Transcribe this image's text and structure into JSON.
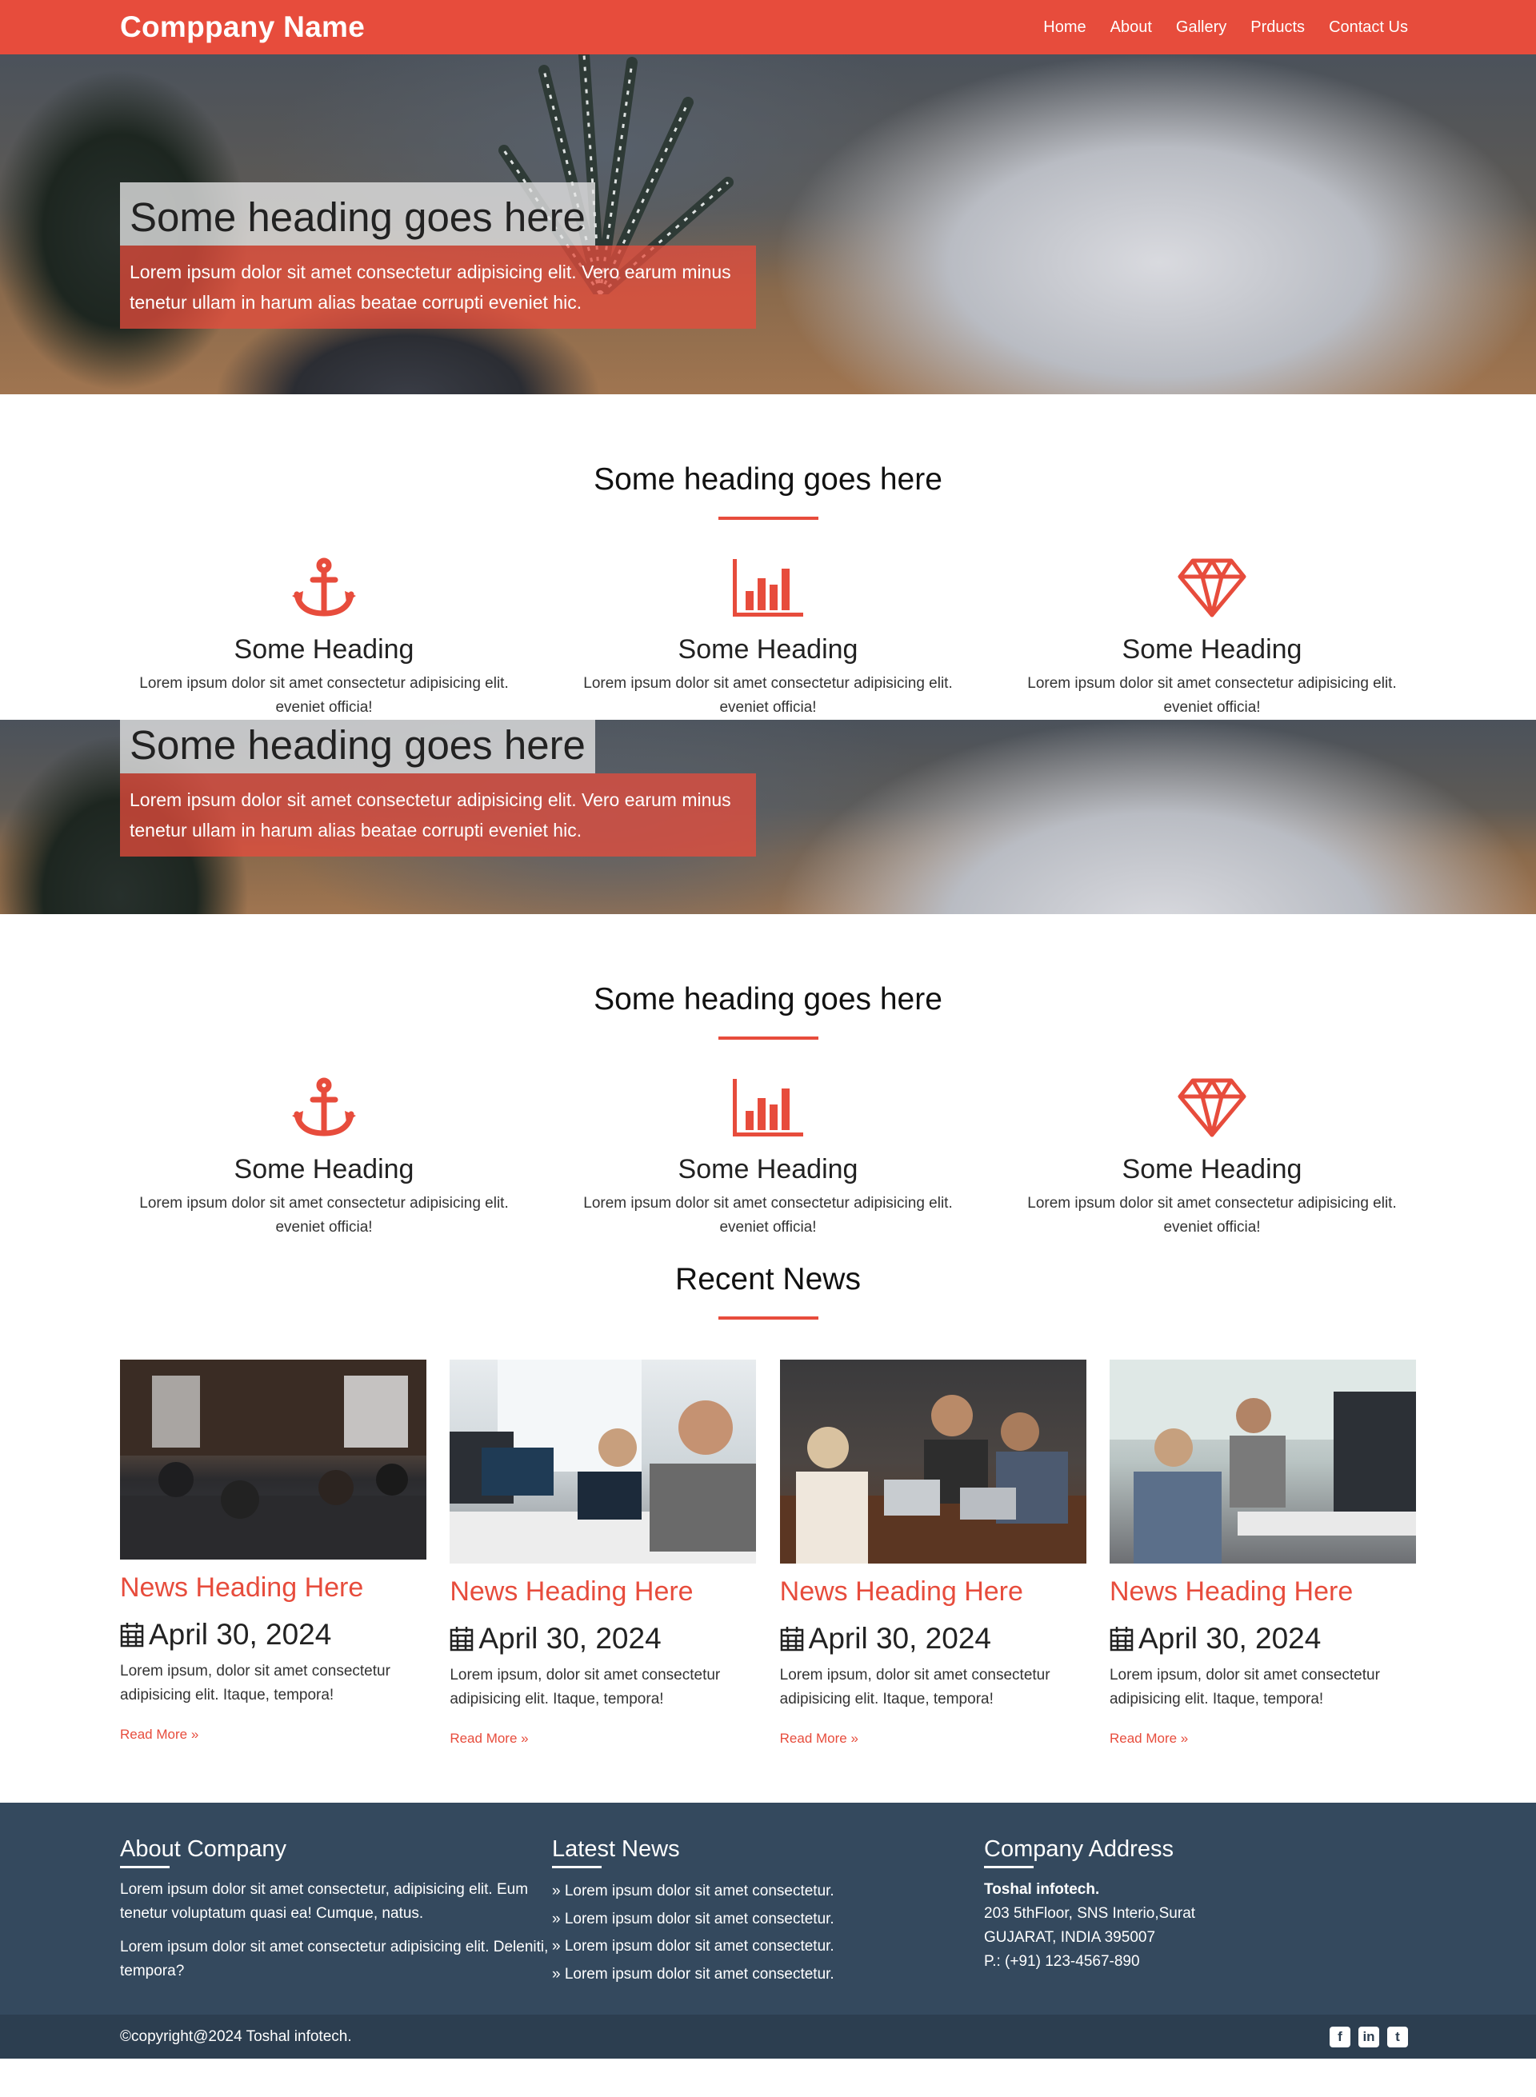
{
  "navbar": {
    "brand": "Comppany Name",
    "links": [
      "Home",
      "About",
      "Gallery",
      "Prducts",
      "Contact Us"
    ]
  },
  "hero": {
    "title": "Some heading goes here",
    "text": "Lorem ipsum dolor sit amet consectetur adipisicing elit. Vero earum minus tenetur ullam in harum alias beatae corrupti eveniet hic."
  },
  "features": {
    "title": "Some heading goes here",
    "items": [
      {
        "icon": "anchor-icon",
        "heading": "Some Heading",
        "text": "Lorem ipsum dolor sit amet consectetur adipisicing elit. eveniet officia!"
      },
      {
        "icon": "bar-chart-icon",
        "heading": "Some Heading",
        "text": "Lorem ipsum dolor sit amet consectetur adipisicing elit. eveniet officia!"
      },
      {
        "icon": "diamond-icon",
        "heading": "Some Heading",
        "text": "Lorem ipsum dolor sit amet consectetur adipisicing elit. eveniet officia!"
      }
    ]
  },
  "news": {
    "title": "Recent News",
    "items": [
      {
        "heading": "News Heading Here",
        "date": "April 30, 2024",
        "text": "Lorem ipsum, dolor sit amet consectetur adipisicing elit. Itaque, tempora!",
        "read_more": "Read More »"
      },
      {
        "heading": "News Heading Here",
        "date": "April 30, 2024",
        "text": "Lorem ipsum, dolor sit amet consectetur adipisicing elit. Itaque, tempora!",
        "read_more": "Read More »"
      },
      {
        "heading": "News Heading Here",
        "date": "April 30, 2024",
        "text": "Lorem ipsum, dolor sit amet consectetur adipisicing elit. Itaque, tempora!",
        "read_more": "Read More »"
      },
      {
        "heading": "News Heading Here",
        "date": "April 30, 2024",
        "text": "Lorem ipsum, dolor sit amet consectetur adipisicing elit. Itaque, tempora!",
        "read_more": "Read More »"
      }
    ]
  },
  "footer": {
    "about": {
      "title": "About Company",
      "p1": "Lorem ipsum dolor sit amet consectetur, adipisicing elit. Eum tenetur voluptatum quasi ea! Cumque, natus.",
      "p2": "Lorem ipsum dolor sit amet consectetur adipisicing elit. Deleniti, tempora?"
    },
    "latest": {
      "title": "Latest News",
      "items": [
        "» Lorem ipsum dolor sit amet consectetur.",
        "» Lorem ipsum dolor sit amet consectetur.",
        "» Lorem ipsum dolor sit amet consectetur.",
        "» Lorem ipsum dolor sit amet consectetur."
      ]
    },
    "address": {
      "title": "Company Address",
      "name": "Toshal infotech.",
      "line1": "203 5thFloor, SNS Interio,Surat",
      "line2": "GUJARAT, INDIA 395007",
      "phone": "P.: (+91) 123-4567-890"
    },
    "copyright": "©copyright@2024 Toshal infotech.",
    "social": [
      "facebook-icon",
      "linkedin-icon",
      "twitter-icon"
    ]
  },
  "colors": {
    "accent": "#e74c3c",
    "footer": "#34495e",
    "footer_bottom": "#2c3e50"
  }
}
